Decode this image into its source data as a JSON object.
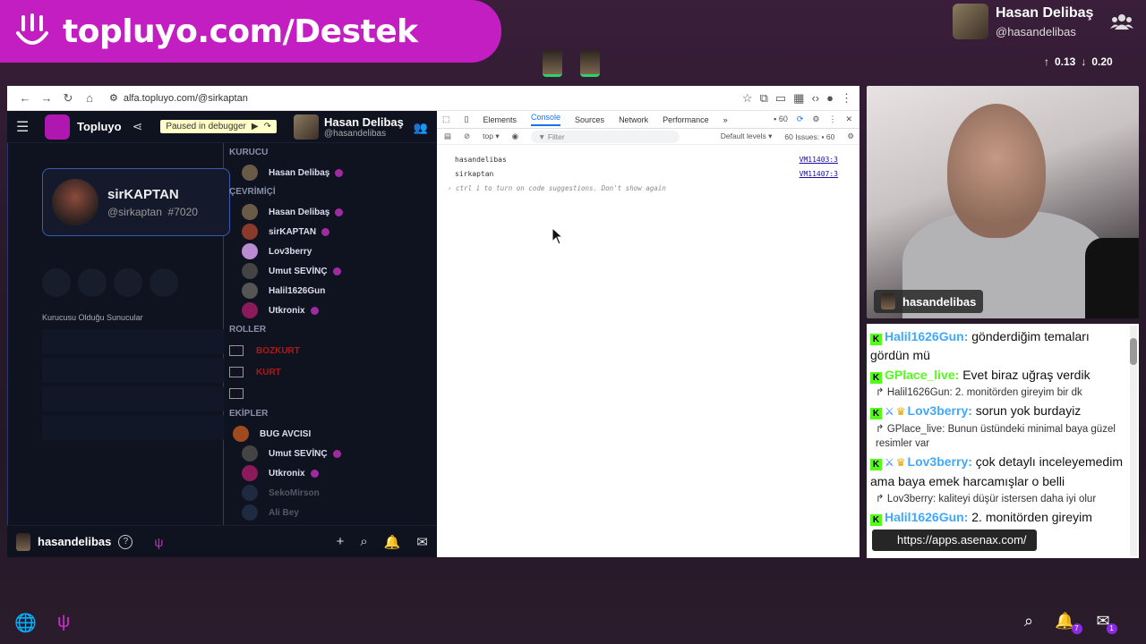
{
  "banner": {
    "text": "topluyo.com/Destek"
  },
  "streamer": {
    "name": "Hasan Delibaş",
    "handle": "@hasandelibas",
    "upload": "0.13",
    "download": "0.20"
  },
  "browser": {
    "url": "alfa.topluyo.com/@sirkaptan",
    "app": {
      "name": "Topluyo",
      "debug_badge": "Paused in debugger",
      "profile_name": "Hasan Delibaş",
      "profile_handle": "@hasandelibas",
      "card_name": "sirKAPTAN",
      "card_handle": "@sirkaptan",
      "card_tag": "#7020",
      "servers_label": "Kurucusu Olduğu Sunucular",
      "sections": {
        "kurucu": "KURUCU",
        "cevrimici": "ÇEVRİMİÇİ",
        "roller": "ROLLER",
        "ekipler": "EKİPLER"
      },
      "founder": [
        "Hasan Delibaş"
      ],
      "online": [
        "Hasan Delibaş",
        "sirKAPTAN",
        "Lov3berry",
        "Umut SEVİNÇ",
        "Halil1626Gun",
        "Utkronix"
      ],
      "roles": [
        {
          "name": "BOZKURT",
          "color": "#b01818"
        },
        {
          "name": "KURT",
          "color": "#b01818"
        },
        {
          "name": "",
          "color": "#2233aa"
        }
      ],
      "team_name": "BUG AVCISI",
      "team_members": [
        "Umut SEVİNÇ",
        "Utkronix",
        "SekoMirson",
        "Ali Bey"
      ],
      "bottom_user": "hasandelibas"
    },
    "devtools": {
      "tabs": [
        "Elements",
        "Console",
        "Sources",
        "Network",
        "Performance"
      ],
      "active_tab": "Console",
      "msg_count": "60",
      "context": "top",
      "filter_placeholder": "Filter",
      "levels": "Default levels",
      "issues": "60 Issues:",
      "issues_count": "60",
      "logs": [
        {
          "text": "hasandelibas",
          "src": "VM11403:3"
        },
        {
          "text": "sirkaptan",
          "src": "VM11407:3"
        }
      ],
      "hint": "ctrl  i  to turn on code suggestions. Don't show again"
    }
  },
  "webcam": {
    "label": "hasandelibas"
  },
  "chat": [
    {
      "user": "Halil1626Gun",
      "text": "gönderdiğim temaları gördün mü",
      "badges": [
        "k"
      ],
      "cls": "u1"
    },
    {
      "user": "GPlace_live",
      "text": "Evet biraz uğraş verdik",
      "badges": [
        "k"
      ],
      "cls": "u2",
      "reply": "Halil1626Gun: 2. monitörden gireyim bir dk"
    },
    {
      "user": "Lov3berry",
      "text": "sorun yok burdayiz",
      "badges": [
        "k",
        "sw",
        "cr"
      ],
      "cls": "u3",
      "reply": "GPlace_live: Bunun üstündeki minimal baya güzel resimler var"
    },
    {
      "user": "Lov3berry",
      "text": "çok detaylı inceleyemedim ama baya emek harcamışlar o belli",
      "badges": [
        "k",
        "sw",
        "cr"
      ],
      "cls": "u3",
      "reply": "Lov3berry: kaliteyi düşür istersen daha iyi olur"
    },
    {
      "user": "Halil1626Gun",
      "text": "2. monitörden gireyim",
      "badges": [
        "k"
      ],
      "cls": "u1"
    }
  ],
  "link_overlay": "https://apps.asenax.com/",
  "bottom": {
    "notif_count": "7",
    "mail_count": "1"
  },
  "colors": {
    "brand": "#c21ec2",
    "kick_green": "#53fc18"
  }
}
